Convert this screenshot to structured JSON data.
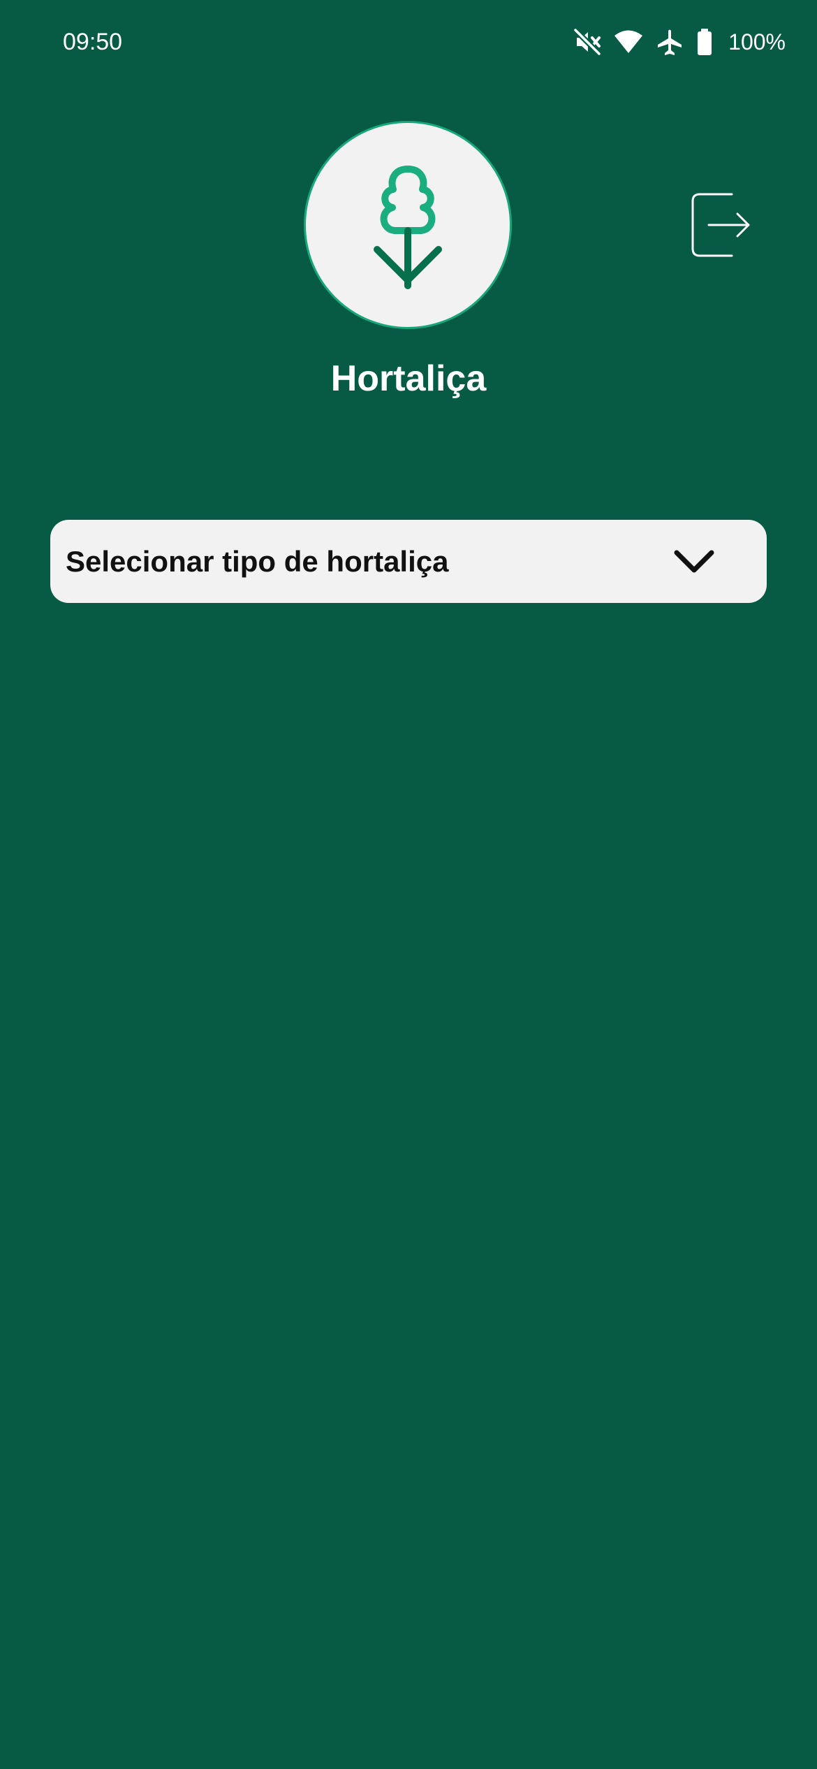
{
  "status_bar": {
    "time": "09:50",
    "icons": [
      "mute-icon",
      "wifi-icon",
      "airplane-icon",
      "battery-icon"
    ],
    "battery_text": "100%"
  },
  "header": {
    "logo_icon": "tree-icon",
    "title": "Hortaliça",
    "logout_icon": "logout-icon"
  },
  "select": {
    "label": "Selecionar tipo de hortaliça",
    "icon": "chevron-down-icon"
  },
  "colors": {
    "background": "#075b44",
    "logo_light_green": "#19ad80",
    "logo_dark_green": "#06704c",
    "select_background": "#f2f2f2"
  }
}
